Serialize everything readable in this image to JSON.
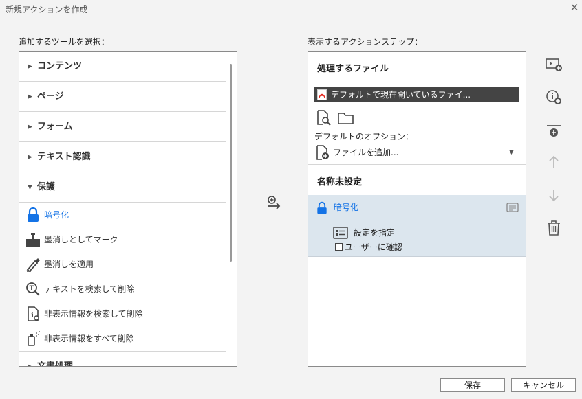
{
  "window": {
    "title": "新規アクションを作成"
  },
  "left": {
    "label": "追加するツールを選択：",
    "categories": [
      "コンテンツ",
      "ページ",
      "フォーム",
      "テキスト認識",
      "保護",
      "文書処理"
    ],
    "tools": [
      "暗号化",
      "墨消しとしてマーク",
      "墨消しを適用",
      "テキストを検索して削除",
      "非表示情報を検索して削除",
      "非表示情報をすべて削除"
    ]
  },
  "right": {
    "label": "表示するアクションステップ：",
    "file_header": "処理するファイル",
    "file_value": "デフォルトで現在開いているファイ...",
    "default_options_label": "デフォルトのオプション：",
    "add_file": "ファイルを追加...",
    "unnamed_header": "名称未設定",
    "step_name": "暗号化",
    "specify_settings": "設定を指定",
    "confirm_user": "ユーザーに確認"
  },
  "buttons": {
    "save": "保存",
    "cancel": "キャンセル"
  },
  "colors": {
    "accent": "#1473e6",
    "selected_bg": "#dce6ee",
    "dark_bar": "#444444"
  }
}
